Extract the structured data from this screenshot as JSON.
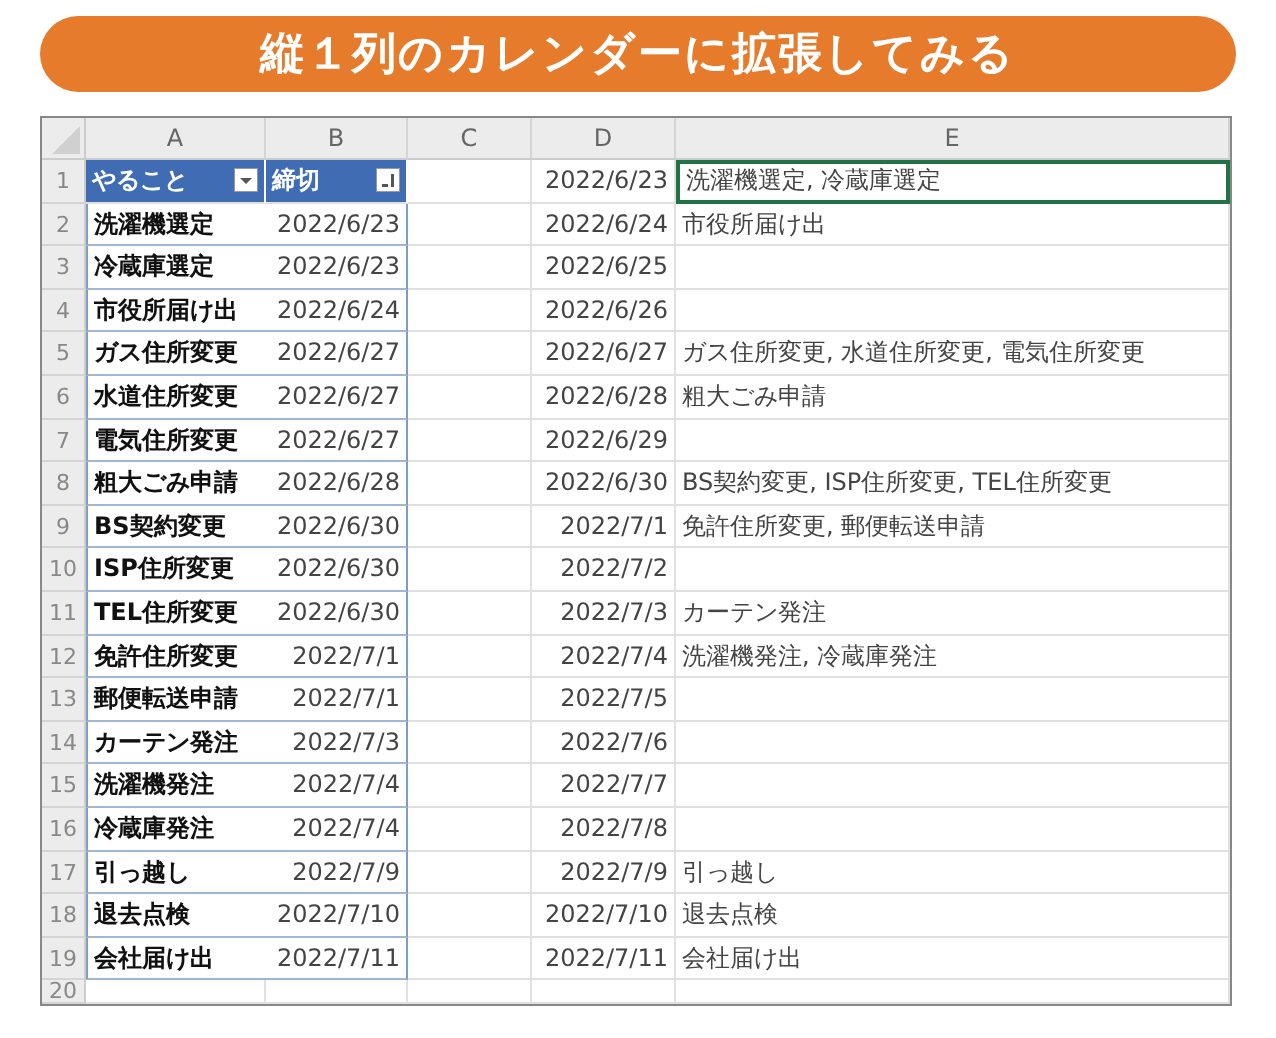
{
  "banner": {
    "title": "縦１列のカレンダーに拡張してみる"
  },
  "sheet": {
    "columns": [
      "A",
      "B",
      "C",
      "D",
      "E"
    ],
    "rows": [
      {
        "num": "1",
        "kind": "header",
        "a": "やること",
        "b": "締切",
        "d": "2022/6/23",
        "e": "洗濯機選定, 冷蔵庫選定",
        "selected": true
      },
      {
        "num": "2",
        "kind": "data",
        "a": "洗濯機選定",
        "b": "2022/6/23",
        "d": "2022/6/24",
        "e": "市役所届け出",
        "selected": false
      },
      {
        "num": "3",
        "kind": "data",
        "a": "冷蔵庫選定",
        "b": "2022/6/23",
        "d": "2022/6/25",
        "selected": false
      },
      {
        "num": "4",
        "kind": "data",
        "a": "市役所届け出",
        "b": "2022/6/24",
        "d": "2022/6/26",
        "selected": false
      },
      {
        "num": "5",
        "kind": "data",
        "a": "ガス住所変更",
        "b": "2022/6/27",
        "d": "2022/6/27",
        "e": "ガス住所変更, 水道住所変更, 電気住所変更",
        "selected": false
      },
      {
        "num": "6",
        "kind": "data",
        "a": "水道住所変更",
        "b": "2022/6/27",
        "d": "2022/6/28",
        "e": "粗大ごみ申請",
        "selected": false
      },
      {
        "num": "7",
        "kind": "data",
        "a": "電気住所変更",
        "b": "2022/6/27",
        "d": "2022/6/29",
        "selected": false
      },
      {
        "num": "8",
        "kind": "data",
        "a": "粗大ごみ申請",
        "b": "2022/6/28",
        "d": "2022/6/30",
        "e": "BS契約変更, ISP住所変更, TEL住所変更",
        "selected": false
      },
      {
        "num": "9",
        "kind": "data",
        "a": "BS契約変更",
        "b": "2022/6/30",
        "d": "2022/7/1",
        "e": "免許住所変更, 郵便転送申請",
        "selected": false
      },
      {
        "num": "10",
        "kind": "data",
        "a": "ISP住所変更",
        "b": "2022/6/30",
        "d": "2022/7/2",
        "selected": false
      },
      {
        "num": "11",
        "kind": "data",
        "a": "TEL住所変更",
        "b": "2022/6/30",
        "d": "2022/7/3",
        "e": "カーテン発注",
        "selected": false
      },
      {
        "num": "12",
        "kind": "data",
        "a": "免許住所変更",
        "b": "2022/7/1",
        "d": "2022/7/4",
        "e": "洗濯機発注, 冷蔵庫発注",
        "selected": false
      },
      {
        "num": "13",
        "kind": "data",
        "a": "郵便転送申請",
        "b": "2022/7/1",
        "d": "2022/7/5",
        "selected": false
      },
      {
        "num": "14",
        "kind": "data",
        "a": "カーテン発注",
        "b": "2022/7/3",
        "d": "2022/7/6",
        "selected": false
      },
      {
        "num": "15",
        "kind": "data",
        "a": "洗濯機発注",
        "b": "2022/7/4",
        "d": "2022/7/7",
        "selected": false
      },
      {
        "num": "16",
        "kind": "data",
        "a": "冷蔵庫発注",
        "b": "2022/7/4",
        "d": "2022/7/8",
        "selected": false
      },
      {
        "num": "17",
        "kind": "data",
        "a": "引っ越し",
        "b": "2022/7/9",
        "d": "2022/7/9",
        "e": "引っ越し",
        "selected": false
      },
      {
        "num": "18",
        "kind": "data",
        "a": "退去点検",
        "b": "2022/7/10",
        "d": "2022/7/10",
        "e": "退去点検",
        "selected": false
      },
      {
        "num": "19",
        "kind": "data",
        "a": "会社届け出",
        "b": "2022/7/11",
        "d": "2022/7/11",
        "e": "会社届け出",
        "selected": false
      },
      {
        "num": "20",
        "kind": "blank",
        "selected": false
      }
    ]
  }
}
